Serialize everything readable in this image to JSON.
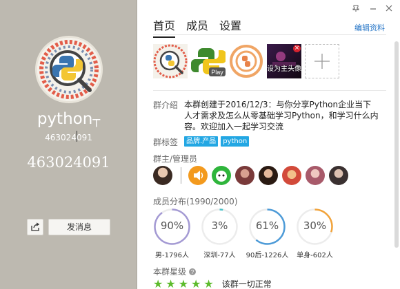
{
  "window": {
    "pin_icon": "pin-icon",
    "minimize_icon": "minimize-icon",
    "close_icon": "close-icon"
  },
  "left": {
    "group_name": "python",
    "group_id_small": "463024091",
    "group_id_big": "463024091",
    "share_icon": "share-icon",
    "send_message_label": "发消息"
  },
  "tabs": [
    {
      "label": "首页",
      "active": true
    },
    {
      "label": "成员",
      "active": false
    },
    {
      "label": "设置",
      "active": false
    }
  ],
  "edit_profile_label": "编辑资料",
  "photos": {
    "set_cover_label": "设为主头像",
    "close_symbol": "×",
    "add_symbol": "+"
  },
  "intro": {
    "label": "群介绍",
    "text": "本群创建于2016/12/3：与你分享Python企业当下人才需求及怎么从零基础学习Python，和学习什么内容。欢迎加入一起学习交流"
  },
  "tags": {
    "label": "群标签",
    "items": [
      "品牌.产品",
      "python"
    ]
  },
  "admins": {
    "label": "群主/管理员",
    "count": 8
  },
  "distribution": {
    "label": "成员分布",
    "count_text": "(1990/2000)",
    "items": [
      {
        "percent_text": "90%",
        "percent": 90,
        "label": "男-1796人",
        "color": "#a49ad4"
      },
      {
        "percent_text": "3%",
        "percent": 3,
        "label": "深圳-77人",
        "color": "#46c2c8"
      },
      {
        "percent_text": "61%",
        "percent": 61,
        "label": "90后-1226人",
        "color": "#4d9bd8"
      },
      {
        "percent_text": "30%",
        "percent": 30,
        "label": "单身-602人",
        "color": "#f2a33a"
      }
    ]
  },
  "rating": {
    "label": "本群星级",
    "info_icon": "info-icon",
    "stars": 5,
    "status_text": "该群一切正常"
  },
  "colors": {
    "left_bg": "#bdb9b0",
    "accent": "#2a78c8",
    "tag_bg": "#23a7e3",
    "star": "#5dbb2c"
  }
}
